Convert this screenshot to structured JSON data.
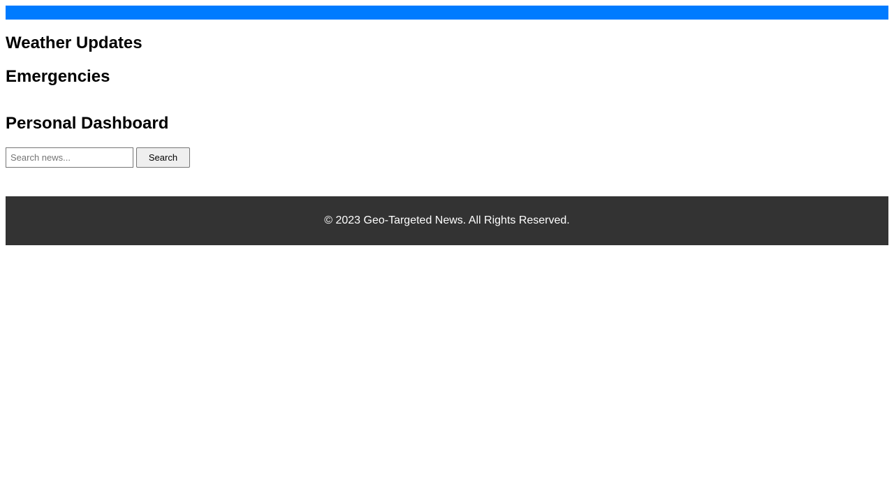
{
  "header": {
    "bar_color": "#007bff"
  },
  "sections": {
    "weather_title": "Weather Updates",
    "emergencies_title": "Emergencies",
    "dashboard_title": "Personal Dashboard"
  },
  "search": {
    "placeholder": "Search news...",
    "value": "",
    "button_label": "Search"
  },
  "footer": {
    "text": "© 2023 Geo-Targeted News. All Rights Reserved.",
    "background_color": "#333333"
  }
}
